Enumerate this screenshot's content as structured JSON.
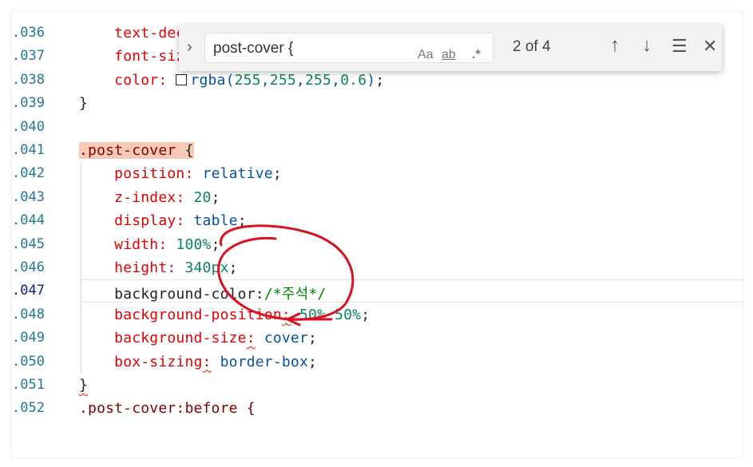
{
  "find_widget": {
    "toggle_icon": "chevron-right-icon",
    "query": "post-cover {",
    "match_case_label": "Aa",
    "whole_word_label": "ab",
    "regex_label": ".*",
    "match_count": "2 of 4",
    "prev_icon": "arrow-up-icon",
    "next_icon": "arrow-down-icon",
    "selection_icon": "find-in-selection-icon",
    "close_icon": "close-icon"
  },
  "lines": [
    {
      "num": ".036",
      "parts": [
        {
          "t": "    "
        },
        {
          "t": "text-deco",
          "c": "prop"
        }
      ]
    },
    {
      "num": ".037",
      "parts": [
        {
          "t": "    "
        },
        {
          "t": "font-size",
          "c": "prop"
        }
      ]
    },
    {
      "num": ".038",
      "parts": [
        {
          "t": "    "
        },
        {
          "t": "color: ",
          "c": "prop"
        },
        {
          "box": true
        },
        {
          "t": "rgba(",
          "c": "kw"
        },
        {
          "t": "255",
          "c": "num"
        },
        {
          "t": ",",
          "c": "kw"
        },
        {
          "t": "255",
          "c": "num"
        },
        {
          "t": ",",
          "c": "kw"
        },
        {
          "t": "255",
          "c": "num"
        },
        {
          "t": ",",
          "c": "kw"
        },
        {
          "t": "0.6",
          "c": "num"
        },
        {
          "t": ")",
          "c": "kw"
        },
        {
          "t": ";"
        }
      ]
    },
    {
      "num": ".039",
      "parts": [
        {
          "t": "}"
        }
      ]
    },
    {
      "num": ".040",
      "parts": []
    },
    {
      "num": ".041",
      "parts": [
        {
          "t": ".post-cover ",
          "c": "sel hl"
        },
        {
          "t": "{",
          "c": "hl"
        }
      ]
    },
    {
      "num": ".042",
      "parts": [
        {
          "t": "    "
        },
        {
          "t": "position: ",
          "c": "prop"
        },
        {
          "t": "relative",
          "c": "kw"
        },
        {
          "t": ";"
        }
      ]
    },
    {
      "num": ".043",
      "parts": [
        {
          "t": "    "
        },
        {
          "t": "z-index: ",
          "c": "prop"
        },
        {
          "t": "20",
          "c": "num"
        },
        {
          "t": ";"
        }
      ]
    },
    {
      "num": ".044",
      "parts": [
        {
          "t": "    "
        },
        {
          "t": "display: ",
          "c": "prop"
        },
        {
          "t": "table",
          "c": "kw"
        },
        {
          "t": ";"
        }
      ]
    },
    {
      "num": ".045",
      "parts": [
        {
          "t": "    "
        },
        {
          "t": "width: ",
          "c": "prop"
        },
        {
          "t": "100%",
          "c": "num"
        },
        {
          "t": ";"
        }
      ]
    },
    {
      "num": ".046",
      "parts": [
        {
          "t": "    "
        },
        {
          "t": "height: ",
          "c": "prop"
        },
        {
          "t": "340px",
          "c": "num"
        },
        {
          "t": ";"
        }
      ]
    },
    {
      "num": ".047",
      "active": true,
      "parts": [
        {
          "t": "    "
        },
        {
          "t": "background-color:"
        },
        {
          "t": "/*주석*/",
          "c": "comment"
        }
      ]
    },
    {
      "num": ".048",
      "parts": [
        {
          "t": "    "
        },
        {
          "t": "background-position",
          "c": "prop"
        },
        {
          "t": ":",
          "c": "prop squig"
        },
        {
          "t": " "
        },
        {
          "t": "50% 50%",
          "c": "num"
        },
        {
          "t": ";"
        }
      ]
    },
    {
      "num": ".049",
      "parts": [
        {
          "t": "    "
        },
        {
          "t": "background-size",
          "c": "prop"
        },
        {
          "t": ":",
          "c": "prop squig"
        },
        {
          "t": " "
        },
        {
          "t": "cover",
          "c": "kw"
        },
        {
          "t": ";"
        }
      ]
    },
    {
      "num": ".050",
      "parts": [
        {
          "t": "    "
        },
        {
          "t": "box-sizing",
          "c": "prop"
        },
        {
          "t": ":",
          "c": "prop squig"
        },
        {
          "t": " "
        },
        {
          "t": "border-box",
          "c": "kw"
        },
        {
          "t": ";"
        }
      ]
    },
    {
      "num": ".051",
      "parts": [
        {
          "t": "}",
          "c": "squig"
        }
      ]
    },
    {
      "num": ".052",
      "parts": [
        {
          "t": ".post-cover:before {",
          "c": "sel"
        }
      ]
    }
  ]
}
